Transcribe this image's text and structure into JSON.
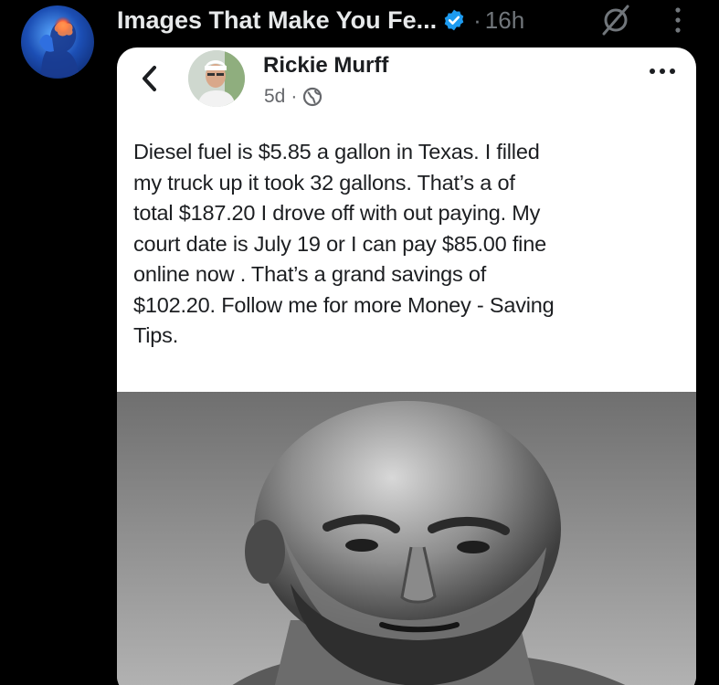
{
  "post": {
    "account_name": "Images That Make You Fe...",
    "separator": "·",
    "time": "16h",
    "icons": {
      "avatar": "brain-headache-avatar",
      "verified": "verified-badge-icon",
      "grok": "grok-icon",
      "more": "more-vertical-icon"
    }
  },
  "embedded_post": {
    "author": "Rickie Murff",
    "age": "5d",
    "separator": "·",
    "text_lines": [
      "Diesel fuel is $5.85 a gallon in Texas. I filled",
      "my truck up it took 32 gallons. That’s a of",
      "total $187.20  I drove off with out paying. My",
      "court date is July 19 or I can pay $85.00 fine",
      "online now . That’s a grand savings of",
      "$102.20.  Follow me for more Money - Saving",
      "Tips."
    ],
    "icons": {
      "back": "back-chevron-icon",
      "audience": "globe-icon",
      "more": "more-horizontal-icon"
    },
    "image_description_icon": "bald-bearded-man-photo"
  },
  "colors": {
    "background": "#000000",
    "primary_text": "#e7e9ea",
    "secondary_text": "#71767b",
    "verified_blue": "#1d9bf0",
    "card_background": "#ffffff",
    "card_text": "#1c1e21",
    "card_meta": "#65676b"
  }
}
